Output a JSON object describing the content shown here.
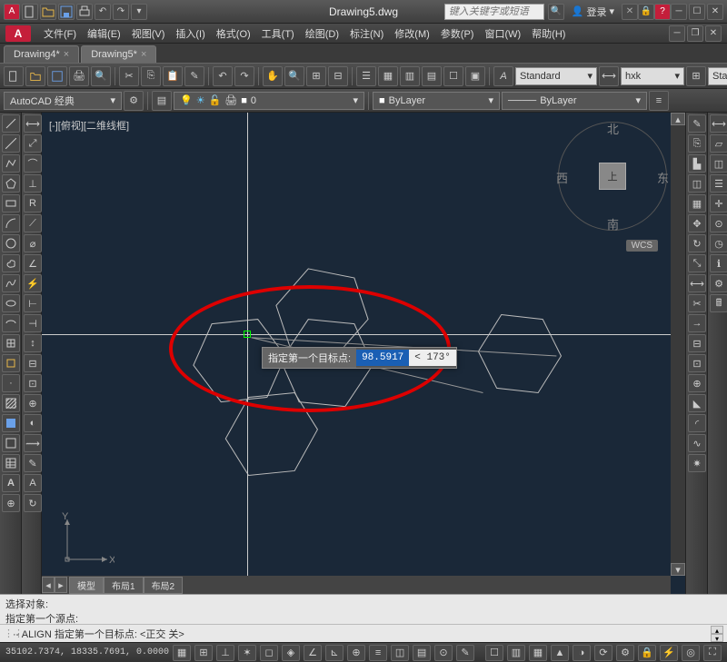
{
  "titlebar": {
    "title": "Drawing5.dwg",
    "search_placeholder": "键入关键字或短语",
    "login_label": "登录"
  },
  "menus": [
    "文件(F)",
    "编辑(E)",
    "视图(V)",
    "插入(I)",
    "格式(O)",
    "工具(T)",
    "绘图(D)",
    "标注(N)",
    "修改(M)",
    "参数(P)",
    "窗口(W)",
    "帮助(H)"
  ],
  "doc_tabs": [
    {
      "label": "Drawing4*",
      "active": false
    },
    {
      "label": "Drawing5*",
      "active": true
    }
  ],
  "style_combo1": "Standard",
  "style_combo2": "hxk",
  "style_combo3": "Stand",
  "workspace_combo": "AutoCAD 经典",
  "layer_combo": "0",
  "linetype_combo": "ByLayer",
  "linetype2_combo": "ByLayer",
  "viewport_label": "[-][俯视][二维线框]",
  "viewcube": {
    "n": "北",
    "s": "南",
    "e": "东",
    "w": "西",
    "face": "上"
  },
  "wcs": "WCS",
  "ucs": {
    "x": "X",
    "y": "Y"
  },
  "dyn_input": {
    "prompt": "指定第一个目标点:",
    "value": "98.5917",
    "angle": "< 173°"
  },
  "model_tabs": [
    "模型",
    "布局1",
    "布局2"
  ],
  "cmd": {
    "line1": "选择对象:",
    "line2": "指定第一个源点:",
    "prompt": "·- ALIGN 指定第一个目标点: <正交 关>"
  },
  "status": {
    "coords": "35102.7374, 18335.7691, 0.0000"
  }
}
